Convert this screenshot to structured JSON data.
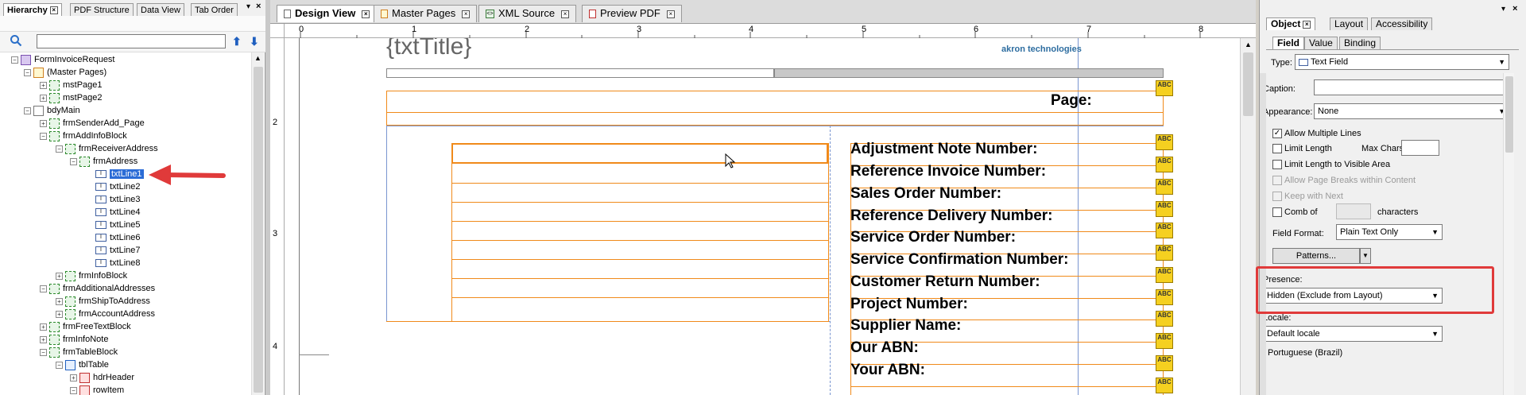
{
  "hierarchy": {
    "tabs": [
      "Hierarchy",
      "PDF Structure",
      "Data View",
      "Tab Order"
    ],
    "search_value": "",
    "tree": [
      {
        "label": "FormInvoiceRequest",
        "kind": "form"
      },
      {
        "label": "(Master Pages)",
        "kind": "master"
      },
      {
        "label": "mstPage1",
        "kind": "page"
      },
      {
        "label": "mstPage2",
        "kind": "page"
      },
      {
        "label": "bdyMain",
        "kind": "page"
      },
      {
        "label": "frmSenderAdd_Page",
        "kind": "sub"
      },
      {
        "label": "frmAddInfoBlock",
        "kind": "sub"
      },
      {
        "label": "frmReceiverAddress",
        "kind": "sub"
      },
      {
        "label": "frmAddress",
        "kind": "sub"
      },
      {
        "label": "txtLine1",
        "kind": "field"
      },
      {
        "label": "txtLine2",
        "kind": "field"
      },
      {
        "label": "txtLine3",
        "kind": "field"
      },
      {
        "label": "txtLine4",
        "kind": "field"
      },
      {
        "label": "txtLine5",
        "kind": "field"
      },
      {
        "label": "txtLine6",
        "kind": "field"
      },
      {
        "label": "txtLine7",
        "kind": "field"
      },
      {
        "label": "txtLine8",
        "kind": "field"
      },
      {
        "label": "frmInfoBlock",
        "kind": "sub"
      },
      {
        "label": "frmAdditionalAddresses",
        "kind": "sub"
      },
      {
        "label": "frmShipToAddress",
        "kind": "sub"
      },
      {
        "label": "frmAccountAddress",
        "kind": "sub"
      },
      {
        "label": "frmFreeTextBlock",
        "kind": "sub"
      },
      {
        "label": "frmInfoNote",
        "kind": "sub"
      },
      {
        "label": "frmTableBlock",
        "kind": "sub"
      },
      {
        "label": "tblTable",
        "kind": "table"
      },
      {
        "label": "hdrHeader",
        "kind": "row"
      },
      {
        "label": "rowItem",
        "kind": "row"
      }
    ]
  },
  "doc_tabs": [
    "Design View",
    "Master Pages",
    "XML Source",
    "Preview PDF"
  ],
  "ruler": {
    "h_labels": [
      "0",
      "1",
      "2",
      "3",
      "4",
      "5",
      "6",
      "7",
      "8"
    ],
    "v_labels": [
      "2",
      "3",
      "4"
    ]
  },
  "design": {
    "title_placeholder": "{txtTitle}",
    "company": "akron technologies",
    "page_label": "Page:",
    "abc_glyph": "ABC",
    "fields": [
      "Adjustment Note Number:",
      "Reference Invoice Number:",
      "Sales Order Number:",
      "Reference Delivery Number:",
      "Service Order Number:",
      "Service Confirmation Number:",
      "Customer Return Number:",
      "Project Number:",
      "Supplier Name:",
      "Our ABN:",
      "Your ABN:"
    ]
  },
  "object_panel": {
    "tabs": [
      "Object",
      "Layout",
      "Accessibility"
    ],
    "subtabs": [
      "Field",
      "Value",
      "Binding"
    ],
    "type_label": "Type:",
    "type_value": "Text Field",
    "caption_label": "Caption:",
    "caption_value": "",
    "appearance_label": "Appearance:",
    "appearance_value": "None",
    "allow_multiple_lines": "Allow Multiple Lines",
    "limit_length": "Limit Length",
    "max_chars_label": "Max Chars:",
    "limit_length_visible": "Limit Length to Visible Area",
    "allow_page_breaks": "Allow Page Breaks within Content",
    "keep_with_next": "Keep with Next",
    "comb_of": "Comb of",
    "characters": "characters",
    "field_format_label": "Field Format:",
    "field_format_value": "Plain Text Only",
    "patterns_button": "Patterns...",
    "presence_label": "Presence:",
    "presence_value": "Hidden (Exclude from Layout)",
    "locale_label": "Locale:",
    "locale_value": "Default locale",
    "locale_note": "Portuguese (Brazil)"
  },
  "colors": {
    "accent_selection": "#2b6cd6",
    "annotation_red": "#e03a3a",
    "field_orange": "#f08a1a"
  }
}
